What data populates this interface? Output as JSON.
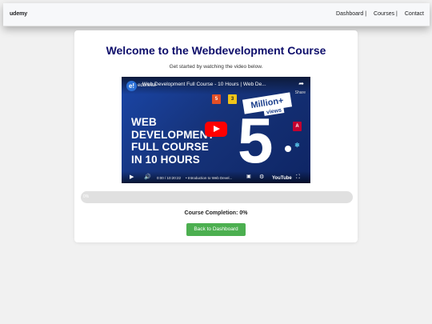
{
  "navbar": {
    "brand": "udemy",
    "links": [
      "Dashboard |",
      "Courses |",
      "Contact"
    ]
  },
  "main": {
    "title": "Welcome to the Webdevelopment Course",
    "subtitle": "Get started by watching the video below."
  },
  "video": {
    "channel_icon": "e!",
    "channel_name": "edureka!",
    "title": "Web Development Full Course - 10 Hours | Web De...",
    "share_label": "Share",
    "thumbnail_text": [
      "WEB",
      "DEVELOPMENT",
      "FULL COURSE",
      "IN 10 HOURS"
    ],
    "badge_million": "Million+",
    "badge_views": "views",
    "big_number": "5",
    "tech_icons": [
      "5",
      "3",
      "A"
    ],
    "time": "0:00 / 10:20:22",
    "chapter": "• Introduction to Web Devel...",
    "player_brand": "YouTube",
    "colors": {
      "play_button": "#ff0000",
      "background": "#1a3e8c"
    }
  },
  "progress": {
    "value": 0,
    "label": "0%",
    "color": "#4caf50"
  },
  "completion_text": "Course Completion: 0%",
  "back_button": "Back to Dashboard"
}
